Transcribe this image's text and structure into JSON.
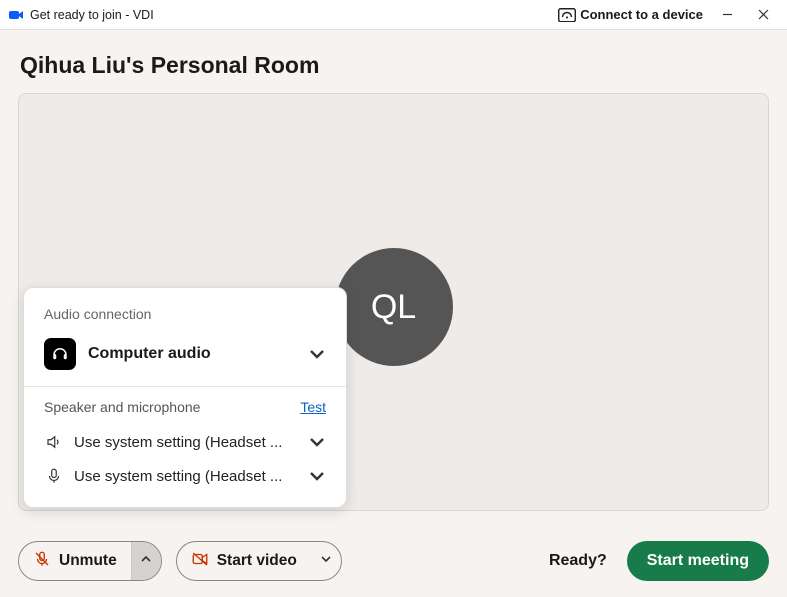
{
  "titlebar": {
    "title": "Get ready to join - VDI",
    "connect_label": "Connect to a device"
  },
  "room": {
    "title": "Qihua Liu's Personal Room",
    "avatar_initials": "QL"
  },
  "audio_popover": {
    "section_label": "Audio connection",
    "mode_label": "Computer audio",
    "sub_label": "Speaker and microphone",
    "test_link": "Test",
    "speaker_label": "Use system setting (Headset ...",
    "mic_label": "Use system setting (Headset ..."
  },
  "controls": {
    "unmute_label": "Unmute",
    "start_video_label": "Start video",
    "ready_label": "Ready?",
    "start_meeting_label": "Start meeting"
  }
}
